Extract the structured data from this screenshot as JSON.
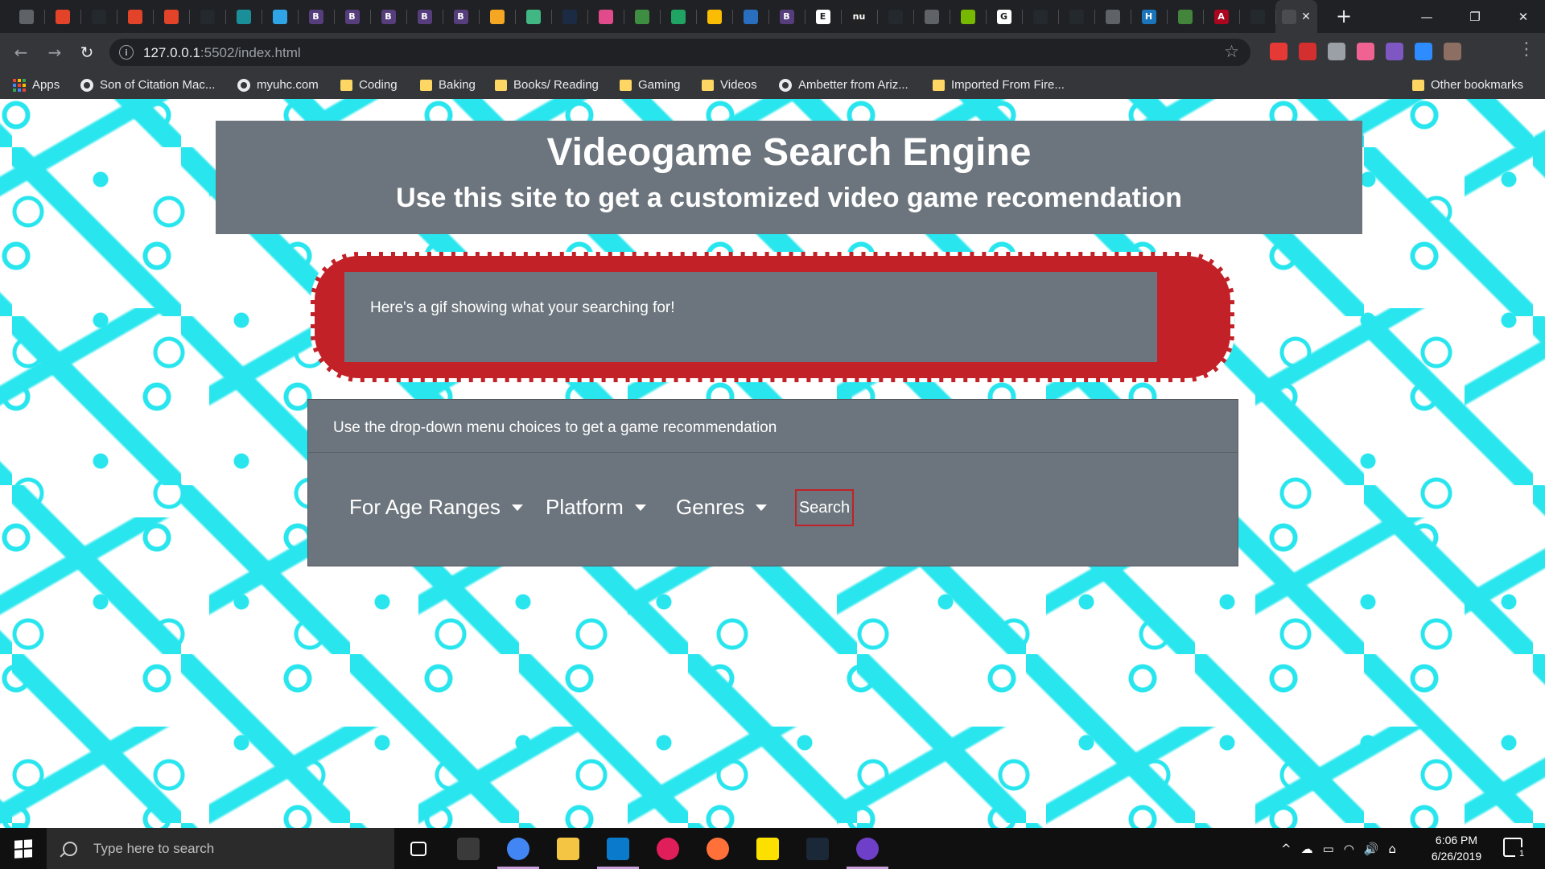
{
  "browser": {
    "tabs": [
      {
        "icon": "globe-icon",
        "color": "#5f6368",
        "glyph": ""
      },
      {
        "icon": "gitlab-icon",
        "color": "#e24329",
        "glyph": ""
      },
      {
        "icon": "github-icon",
        "color": "#24292e",
        "glyph": ""
      },
      {
        "icon": "gitlab-icon",
        "color": "#e24329",
        "glyph": ""
      },
      {
        "icon": "gitlab-icon",
        "color": "#e24329",
        "glyph": ""
      },
      {
        "icon": "github-icon",
        "color": "#24292e",
        "glyph": ""
      },
      {
        "icon": "codepen-icon",
        "color": "#1a8f9a",
        "glyph": ""
      },
      {
        "icon": "play-icon",
        "color": "#2fa4e7",
        "glyph": ""
      },
      {
        "icon": "bootstrap-icon",
        "color": "#563d7c",
        "glyph": "B"
      },
      {
        "icon": "bootstrap-icon",
        "color": "#563d7c",
        "glyph": "B"
      },
      {
        "icon": "bootstrap-icon",
        "color": "#563d7c",
        "glyph": "B"
      },
      {
        "icon": "bootstrap-icon",
        "color": "#563d7c",
        "glyph": "B"
      },
      {
        "icon": "bootstrap-icon",
        "color": "#563d7c",
        "glyph": "B"
      },
      {
        "icon": "search-doc-icon",
        "color": "#f5a623",
        "glyph": ""
      },
      {
        "icon": "vue-icon",
        "color": "#41b883",
        "glyph": ""
      },
      {
        "icon": "c-icon",
        "color": "#1c2b44",
        "glyph": ""
      },
      {
        "icon": "pink-app-icon",
        "color": "#e14a8b",
        "glyph": ""
      },
      {
        "icon": "leaf-icon",
        "color": "#3e8e41",
        "glyph": ""
      },
      {
        "icon": "drive-icon",
        "color": "#1fa463",
        "glyph": ""
      },
      {
        "icon": "drive-icon",
        "color": "#fbbc04",
        "glyph": ""
      },
      {
        "icon": "wave-icon",
        "color": "#2a6ebf",
        "glyph": ""
      },
      {
        "icon": "bootstrap-icon",
        "color": "#563d7c",
        "glyph": "B"
      },
      {
        "icon": "e-icon",
        "color": "#ffffff",
        "glyph": "E"
      },
      {
        "icon": "nu-icon",
        "color": "#222222",
        "glyph": "nu"
      },
      {
        "icon": "github-icon",
        "color": "#24292e",
        "glyph": ""
      },
      {
        "icon": "globe-icon",
        "color": "#5f6368",
        "glyph": ""
      },
      {
        "icon": "nvidia-icon",
        "color": "#76b900",
        "glyph": ""
      },
      {
        "icon": "google-icon",
        "color": "#ffffff",
        "glyph": "G"
      },
      {
        "icon": "github-icon",
        "color": "#24292e",
        "glyph": ""
      },
      {
        "icon": "github-icon",
        "color": "#24292e",
        "glyph": ""
      },
      {
        "icon": "globe-icon",
        "color": "#5f6368",
        "glyph": ""
      },
      {
        "icon": "h-icon",
        "color": "#1b75bc",
        "glyph": "H"
      },
      {
        "icon": "node-icon",
        "color": "#43853d",
        "glyph": ""
      },
      {
        "icon": "arizona-icon",
        "color": "#ab0520",
        "glyph": "A"
      },
      {
        "icon": "github-icon",
        "color": "#24292e",
        "glyph": ""
      }
    ],
    "active_tab_close": "✕",
    "new_tab": "+",
    "window_controls": {
      "minimize": "—",
      "restore": "❐",
      "close": "✕"
    },
    "nav": {
      "back": "←",
      "forward": "→",
      "reload": "↻"
    },
    "url_host": "127.0.0.1",
    "url_path": ":5502/index.html",
    "info_glyph": "i",
    "star": "☆",
    "menu": "⋮",
    "extensions": [
      "#e53935",
      "#d32f2f",
      "#9aa0a6",
      "#f06292",
      "#7e57c2",
      "#2d8cff",
      "#8d6e63"
    ],
    "bookmarks": [
      {
        "label": "Apps",
        "type": "apps"
      },
      {
        "label": "Son of Citation Mac...",
        "type": "globe"
      },
      {
        "label": "myuhc.com",
        "type": "globe"
      },
      {
        "label": "Coding",
        "type": "folder"
      },
      {
        "label": "Baking",
        "type": "folder"
      },
      {
        "label": "Books/ Reading",
        "type": "folder"
      },
      {
        "label": "Gaming",
        "type": "folder"
      },
      {
        "label": "Videos",
        "type": "folder"
      },
      {
        "label": "Ambetter from Ariz...",
        "type": "globe"
      },
      {
        "label": "Imported From Fire...",
        "type": "folder"
      }
    ],
    "other_bookmarks": "Other bookmarks"
  },
  "page": {
    "title": "Videogame Search Engine",
    "subtitle": "Use this site to get a customized video game recomendation",
    "gif_text": "Here's a gif showing what your searching for!",
    "card_header": "Use the drop-down menu choices to get a game recommendation",
    "dropdowns": [
      "For Age Ranges",
      "Platform",
      "Genres"
    ],
    "search_button": "Search",
    "accent_red": "#c22127",
    "panel_gray": "#6c757d",
    "pattern_cyan": "#29e6ee"
  },
  "taskbar": {
    "search_placeholder": "Type here to search",
    "apps": [
      {
        "icon": "task-view-icon",
        "color": "#ffffff",
        "open": false
      },
      {
        "icon": "n-app-icon",
        "color": "#3a3a3a",
        "open": false
      },
      {
        "icon": "chrome-icon",
        "color": "#4285f4",
        "open": true
      },
      {
        "icon": "file-explorer-icon",
        "color": "#f4c542",
        "open": false
      },
      {
        "icon": "vscode-icon",
        "color": "#0a7acc",
        "open": true
      },
      {
        "icon": "slack-icon",
        "color": "#e01e5a",
        "open": false
      },
      {
        "icon": "firefox-icon",
        "color": "#ff7139",
        "open": false
      },
      {
        "icon": "sticky-notes-icon",
        "color": "#fce100",
        "open": false
      },
      {
        "icon": "steam-icon",
        "color": "#1b2838",
        "open": false
      },
      {
        "icon": "github-desktop-icon",
        "color": "#6e40c9",
        "open": true
      }
    ],
    "tray_glyphs": [
      "^",
      "☁",
      "▭",
      "◠",
      "🔊",
      "⌂"
    ],
    "time": "6:06 PM",
    "date": "6/26/2019",
    "notifications": "1"
  }
}
